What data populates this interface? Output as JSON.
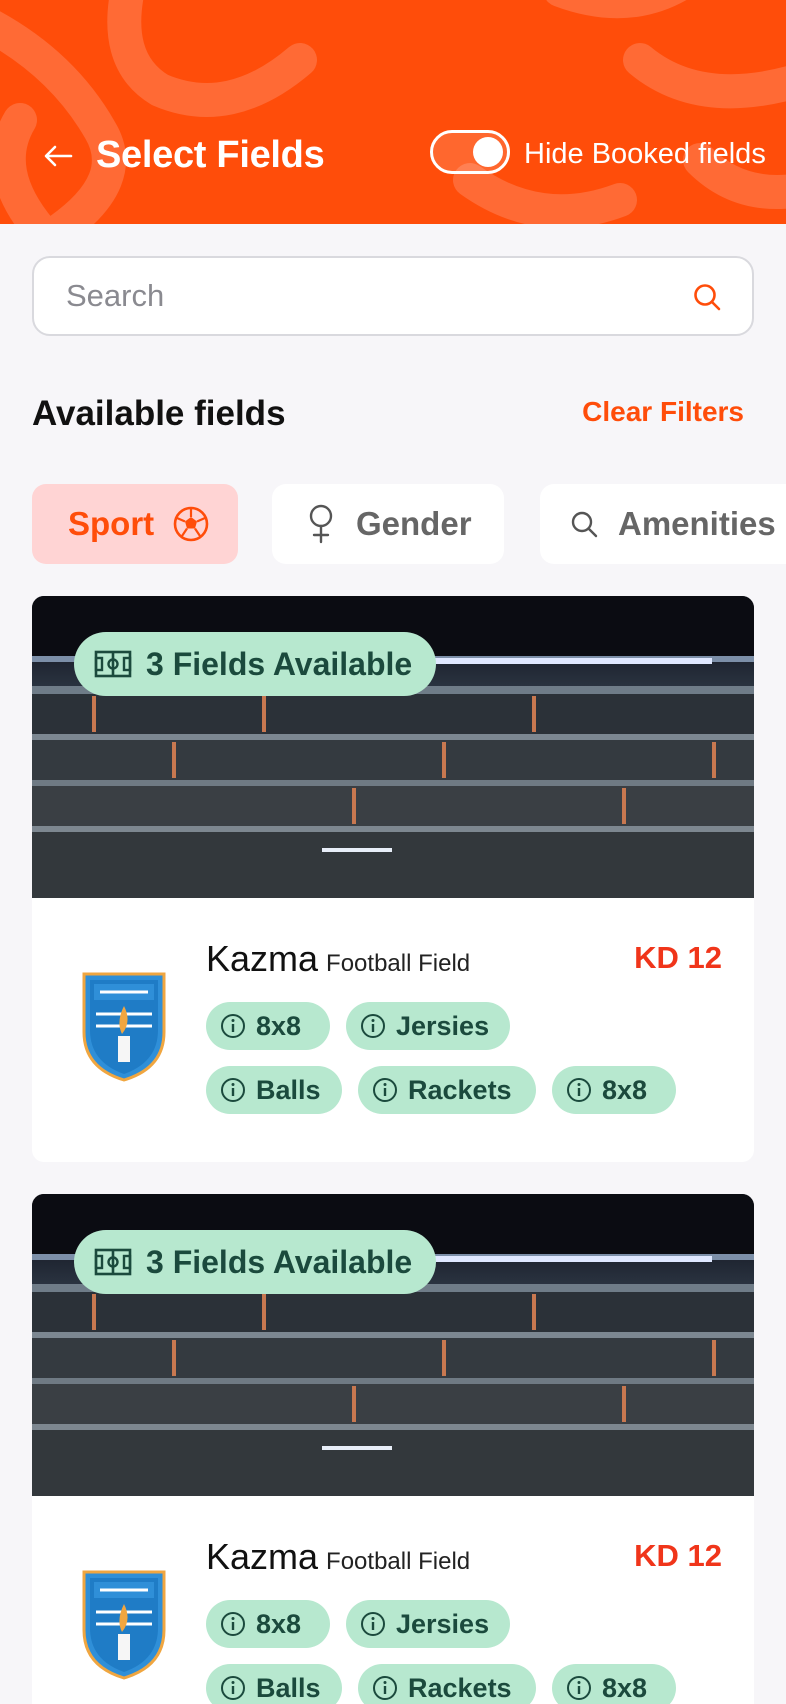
{
  "header": {
    "title": "Select Fields",
    "toggle_label": "Hide Booked fields",
    "toggle_on": true,
    "background_color": "#ff4d0a"
  },
  "search": {
    "placeholder": "Search"
  },
  "section": {
    "title": "Available fields",
    "clear_label": "Clear Filters"
  },
  "filters": [
    {
      "label": "Sport",
      "icon": "soccer-ball-icon",
      "active": true
    },
    {
      "label": "Gender",
      "icon": "female-icon",
      "active": false
    },
    {
      "label": "Amenities",
      "icon": "search-icon",
      "active": false
    }
  ],
  "cards": [
    {
      "badge": "3 Fields Available",
      "name": "Kazma",
      "type": "Football Field",
      "price": "KD 12",
      "tags_row1": [
        "8x8",
        "Jersies"
      ],
      "tags_row2": [
        "Balls",
        "Rackets",
        "8x8"
      ]
    },
    {
      "badge": "3 Fields Available",
      "name": "Kazma",
      "type": "Football Field",
      "price": "KD 12",
      "tags_row1": [
        "8x8",
        "Jersies"
      ],
      "tags_row2": [
        "Balls",
        "Rackets",
        "8x8"
      ]
    }
  ]
}
